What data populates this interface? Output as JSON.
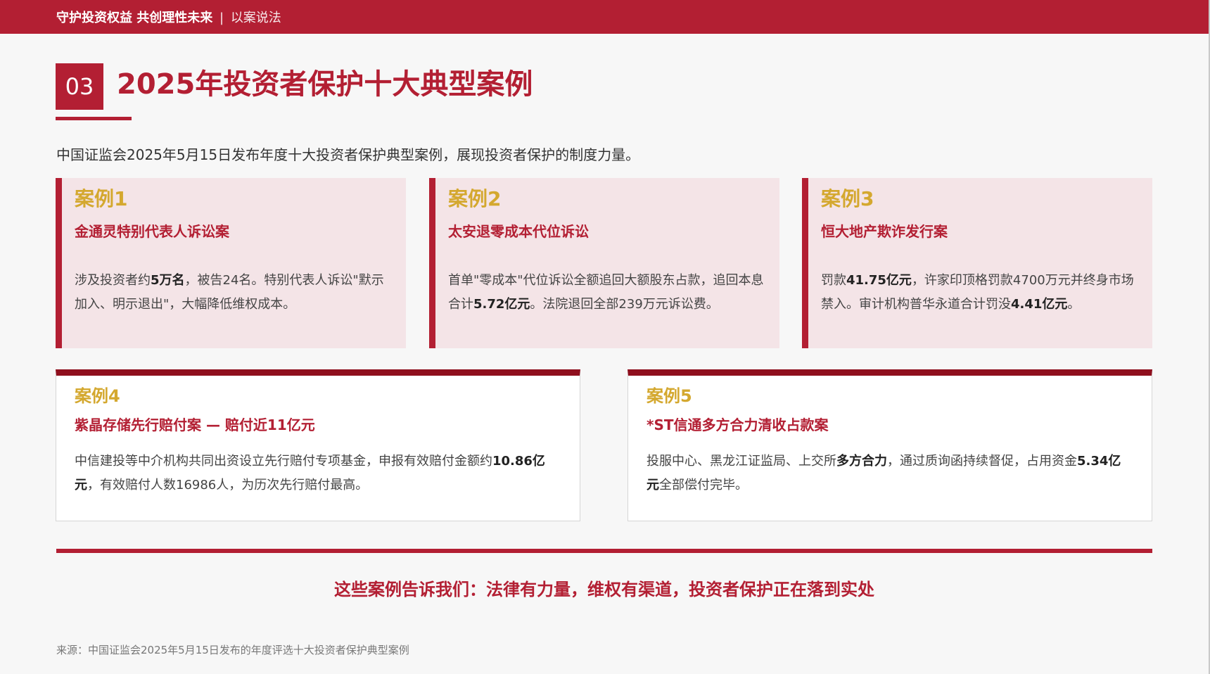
{
  "header": {
    "title_strong": "守护投资权益 共创理性未来",
    "separator": "|",
    "subtitle": "以案说法"
  },
  "section": {
    "number": "03",
    "title": "2025年投资者保护十大典型案例"
  },
  "intro": "中国证监会2025年5月15日发布年度十大投资者保护典型案例，展现投资者保护的制度力量。",
  "cases": [
    {
      "no": "案例1",
      "title": "金通灵特别代表人诉讼案",
      "desc": [
        {
          "t": "涉及投资者约"
        },
        {
          "t": "5万名",
          "b": true
        },
        {
          "t": "，被告24名。特别代表人诉讼\"默示加入、明示退出\"，大幅降低维权成本。"
        }
      ]
    },
    {
      "no": "案例2",
      "title": "太安退零成本代位诉讼",
      "desc": [
        {
          "t": "首单\"零成本\"代位诉讼全额追回大额股东占款，追回本息合计"
        },
        {
          "t": "5.72亿元",
          "b": true
        },
        {
          "t": "。法院退回全部239万元诉讼费。"
        }
      ]
    },
    {
      "no": "案例3",
      "title": "恒大地产欺诈发行案",
      "desc": [
        {
          "t": "罚款"
        },
        {
          "t": "41.75亿元",
          "b": true
        },
        {
          "t": "，许家印顶格罚款4700万元并终身市场禁入。审计机构普华永道合计罚没"
        },
        {
          "t": "4.41亿元",
          "b": true
        },
        {
          "t": "。"
        }
      ]
    },
    {
      "no": "案例4",
      "title": "紫晶存储先行赔付案 — 赔付近11亿元",
      "desc": [
        {
          "t": "中信建投等中介机构共同出资设立先行赔付专项基金，申报有效赔付金额约"
        },
        {
          "t": "10.86亿元",
          "b": true
        },
        {
          "t": "，有效赔付人数16986人，为历次先行赔付最高。"
        }
      ]
    },
    {
      "no": "案例5",
      "title": "*ST信通多方合力清收占款案",
      "desc": [
        {
          "t": "投服中心、黑龙江证监局、上交所"
        },
        {
          "t": "多方合力",
          "b": true
        },
        {
          "t": "，通过质询函持续督促，占用资金"
        },
        {
          "t": "5.34亿元",
          "b": true
        },
        {
          "t": "全部偿付完毕。"
        }
      ]
    }
  ],
  "takeaway": "这些案例告诉我们：法律有力量，维权有渠道，投资者保护正在落到实处",
  "source": "来源：中国证监会2025年5月15日发布的年度评选十大投资者保护典型案例",
  "colors": {
    "brand_red": "#b31f33",
    "dark_red": "#8f0f1e",
    "gold": "#d4a82f",
    "card_pink": "#f4e4e7"
  }
}
